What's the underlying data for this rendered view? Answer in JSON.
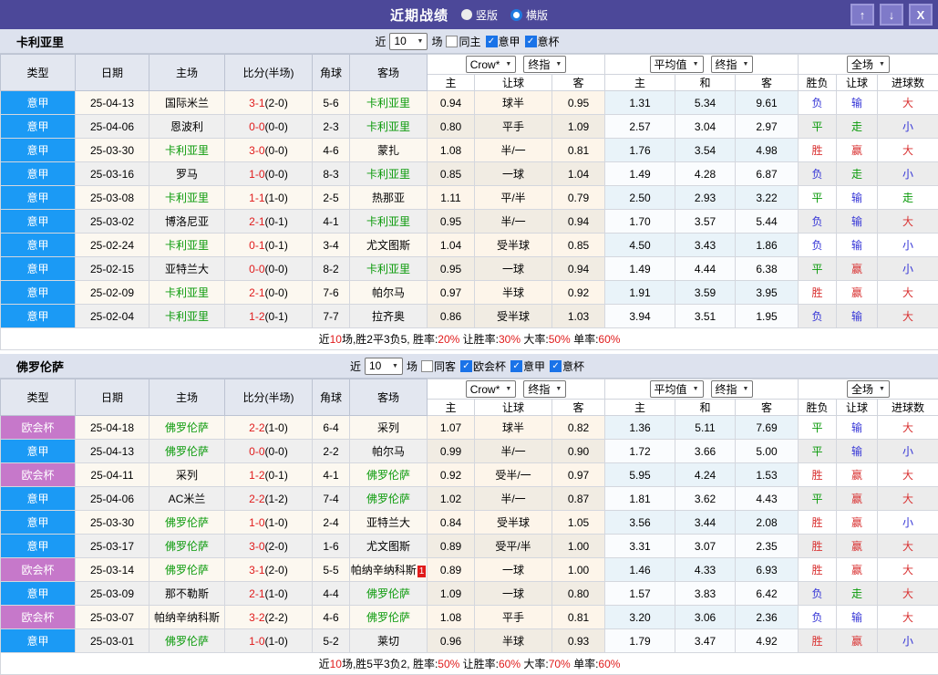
{
  "titlebar": {
    "title": "近期战绩",
    "layout_radios": [
      {
        "label": "竖版",
        "selected": false
      },
      {
        "label": "横版",
        "selected": true
      }
    ],
    "window_buttons": [
      {
        "name": "move-up",
        "glyph": "↑"
      },
      {
        "name": "move-down",
        "glyph": "↓"
      },
      {
        "name": "close",
        "glyph": "X"
      }
    ]
  },
  "colors": {
    "titlebar_purple": "#4c4899",
    "serie_a_badge_blue": "#1b9af5",
    "conference_badge_purple": "#c678ca",
    "team_highlight_green": "#0a9a0a",
    "score_red": "#e01b1b",
    "win_red": "#d93333",
    "draw_green": "#0a9a0a",
    "loss_blue": "#3434d6"
  },
  "filter_labels": {
    "recent": "近",
    "games": "场"
  },
  "columns": {
    "type": "类型",
    "date": "日期",
    "home": "主场",
    "score": "比分(半场)",
    "corner": "角球",
    "away": "客场",
    "sub": [
      "主",
      "让球",
      "客",
      "主",
      "和",
      "客",
      "胜负",
      "让球",
      "进球数"
    ],
    "dropdowns": {
      "bookmaker": "Crow*",
      "final_1": "终指",
      "average": "平均值",
      "final_2": "终指",
      "scope": "全场"
    }
  },
  "tables": [
    {
      "team": "卡利亚里",
      "filter": {
        "count": "10",
        "options": [
          {
            "label": "同主",
            "checked": false
          },
          {
            "label": "意甲",
            "checked": true
          },
          {
            "label": "意杯",
            "checked": true
          }
        ]
      },
      "rows": [
        {
          "league": "意甲",
          "league_type": "blue",
          "date": "25-04-13",
          "home": "国际米兰",
          "home_green": false,
          "score": "3-1",
          "half": "(2-0)",
          "corner": "5-6",
          "away": "卡利亚里",
          "away_green": true,
          "odds": [
            "0.94",
            "球半",
            "0.95"
          ],
          "avg": [
            "1.31",
            "5.34",
            "9.61"
          ],
          "results": [
            [
              "负",
              "b"
            ],
            [
              "输",
              "b"
            ],
            [
              "大",
              "r"
            ]
          ]
        },
        {
          "league": "意甲",
          "league_type": "blue",
          "date": "25-04-06",
          "home": "恩波利",
          "home_green": false,
          "score": "0-0",
          "half": "(0-0)",
          "corner": "2-3",
          "away": "卡利亚里",
          "away_green": true,
          "odds": [
            "0.80",
            "平手",
            "1.09"
          ],
          "avg": [
            "2.57",
            "3.04",
            "2.97"
          ],
          "results": [
            [
              "平",
              "g"
            ],
            [
              "走",
              "g"
            ],
            [
              "小",
              "b"
            ]
          ]
        },
        {
          "league": "意甲",
          "league_type": "blue",
          "date": "25-03-30",
          "home": "卡利亚里",
          "home_green": true,
          "score": "3-0",
          "half": "(0-0)",
          "corner": "4-6",
          "away": "蒙扎",
          "away_green": false,
          "odds": [
            "1.08",
            "半/一",
            "0.81"
          ],
          "avg": [
            "1.76",
            "3.54",
            "4.98"
          ],
          "results": [
            [
              "胜",
              "r"
            ],
            [
              "赢",
              "r"
            ],
            [
              "大",
              "r"
            ]
          ]
        },
        {
          "league": "意甲",
          "league_type": "blue",
          "date": "25-03-16",
          "home": "罗马",
          "home_green": false,
          "score": "1-0",
          "half": "(0-0)",
          "corner": "8-3",
          "away": "卡利亚里",
          "away_green": true,
          "odds": [
            "0.85",
            "一球",
            "1.04"
          ],
          "avg": [
            "1.49",
            "4.28",
            "6.87"
          ],
          "results": [
            [
              "负",
              "b"
            ],
            [
              "走",
              "g"
            ],
            [
              "小",
              "b"
            ]
          ]
        },
        {
          "league": "意甲",
          "league_type": "blue",
          "date": "25-03-08",
          "home": "卡利亚里",
          "home_green": true,
          "score": "1-1",
          "half": "(1-0)",
          "corner": "2-5",
          "away": "热那亚",
          "away_green": false,
          "odds": [
            "1.11",
            "平/半",
            "0.79"
          ],
          "avg": [
            "2.50",
            "2.93",
            "3.22"
          ],
          "results": [
            [
              "平",
              "g"
            ],
            [
              "输",
              "b"
            ],
            [
              "走",
              "g"
            ]
          ]
        },
        {
          "league": "意甲",
          "league_type": "blue",
          "date": "25-03-02",
          "home": "博洛尼亚",
          "home_green": false,
          "score": "2-1",
          "half": "(0-1)",
          "corner": "4-1",
          "away": "卡利亚里",
          "away_green": true,
          "odds": [
            "0.95",
            "半/一",
            "0.94"
          ],
          "avg": [
            "1.70",
            "3.57",
            "5.44"
          ],
          "results": [
            [
              "负",
              "b"
            ],
            [
              "输",
              "b"
            ],
            [
              "大",
              "r"
            ]
          ]
        },
        {
          "league": "意甲",
          "league_type": "blue",
          "date": "25-02-24",
          "home": "卡利亚里",
          "home_green": true,
          "score": "0-1",
          "half": "(0-1)",
          "corner": "3-4",
          "away": "尤文图斯",
          "away_green": false,
          "odds": [
            "1.04",
            "受半球",
            "0.85"
          ],
          "avg": [
            "4.50",
            "3.43",
            "1.86"
          ],
          "results": [
            [
              "负",
              "b"
            ],
            [
              "输",
              "b"
            ],
            [
              "小",
              "b"
            ]
          ]
        },
        {
          "league": "意甲",
          "league_type": "blue",
          "date": "25-02-15",
          "home": "亚特兰大",
          "home_green": false,
          "score": "0-0",
          "half": "(0-0)",
          "corner": "8-2",
          "away": "卡利亚里",
          "away_green": true,
          "odds": [
            "0.95",
            "一球",
            "0.94"
          ],
          "avg": [
            "1.49",
            "4.44",
            "6.38"
          ],
          "results": [
            [
              "平",
              "g"
            ],
            [
              "赢",
              "r"
            ],
            [
              "小",
              "b"
            ]
          ]
        },
        {
          "league": "意甲",
          "league_type": "blue",
          "date": "25-02-09",
          "home": "卡利亚里",
          "home_green": true,
          "score": "2-1",
          "half": "(0-0)",
          "corner": "7-6",
          "away": "帕尔马",
          "away_green": false,
          "odds": [
            "0.97",
            "半球",
            "0.92"
          ],
          "avg": [
            "1.91",
            "3.59",
            "3.95"
          ],
          "results": [
            [
              "胜",
              "r"
            ],
            [
              "赢",
              "r"
            ],
            [
              "大",
              "r"
            ]
          ]
        },
        {
          "league": "意甲",
          "league_type": "blue",
          "date": "25-02-04",
          "home": "卡利亚里",
          "home_green": true,
          "score": "1-2",
          "half": "(0-1)",
          "corner": "7-7",
          "away": "拉齐奥",
          "away_green": false,
          "odds": [
            "0.86",
            "受半球",
            "1.03"
          ],
          "avg": [
            "3.94",
            "3.51",
            "1.95"
          ],
          "results": [
            [
              "负",
              "b"
            ],
            [
              "输",
              "b"
            ],
            [
              "大",
              "r"
            ]
          ]
        }
      ],
      "footer": [
        {
          "text": "近",
          "red": false
        },
        {
          "text": "10",
          "red": true
        },
        {
          "text": "场,胜2平3负5, 胜率:",
          "red": false
        },
        {
          "text": "20%",
          "red": true
        },
        {
          "text": " 让胜率:",
          "red": false
        },
        {
          "text": "30%",
          "red": true
        },
        {
          "text": " 大率:",
          "red": false
        },
        {
          "text": "50%",
          "red": true
        },
        {
          "text": " 单率:",
          "red": false
        },
        {
          "text": "60%",
          "red": true
        }
      ]
    },
    {
      "team": "佛罗伦萨",
      "filter": {
        "count": "10",
        "options": [
          {
            "label": "同客",
            "checked": false
          },
          {
            "label": "欧会杯",
            "checked": true
          },
          {
            "label": "意甲",
            "checked": true
          },
          {
            "label": "意杯",
            "checked": true
          }
        ]
      },
      "rows": [
        {
          "league": "欧会杯",
          "league_type": "purple",
          "date": "25-04-18",
          "home": "佛罗伦萨",
          "home_green": true,
          "score": "2-2",
          "half": "(1-0)",
          "corner": "6-4",
          "away": "采列",
          "away_green": false,
          "odds": [
            "1.07",
            "球半",
            "0.82"
          ],
          "avg": [
            "1.36",
            "5.11",
            "7.69"
          ],
          "results": [
            [
              "平",
              "g"
            ],
            [
              "输",
              "b"
            ],
            [
              "大",
              "r"
            ]
          ]
        },
        {
          "league": "意甲",
          "league_type": "blue",
          "date": "25-04-13",
          "home": "佛罗伦萨",
          "home_green": true,
          "score": "0-0",
          "half": "(0-0)",
          "corner": "2-2",
          "away": "帕尔马",
          "away_green": false,
          "odds": [
            "0.99",
            "半/一",
            "0.90"
          ],
          "avg": [
            "1.72",
            "3.66",
            "5.00"
          ],
          "results": [
            [
              "平",
              "g"
            ],
            [
              "输",
              "b"
            ],
            [
              "小",
              "b"
            ]
          ]
        },
        {
          "league": "欧会杯",
          "league_type": "purple",
          "date": "25-04-11",
          "home": "采列",
          "home_green": false,
          "score": "1-2",
          "half": "(0-1)",
          "corner": "4-1",
          "away": "佛罗伦萨",
          "away_green": true,
          "odds": [
            "0.92",
            "受半/一",
            "0.97"
          ],
          "avg": [
            "5.95",
            "4.24",
            "1.53"
          ],
          "results": [
            [
              "胜",
              "r"
            ],
            [
              "赢",
              "r"
            ],
            [
              "大",
              "r"
            ]
          ]
        },
        {
          "league": "意甲",
          "league_type": "blue",
          "date": "25-04-06",
          "home": "AC米兰",
          "home_green": false,
          "score": "2-2",
          "half": "(1-2)",
          "corner": "7-4",
          "away": "佛罗伦萨",
          "away_green": true,
          "odds": [
            "1.02",
            "半/一",
            "0.87"
          ],
          "avg": [
            "1.81",
            "3.62",
            "4.43"
          ],
          "results": [
            [
              "平",
              "g"
            ],
            [
              "赢",
              "r"
            ],
            [
              "大",
              "r"
            ]
          ]
        },
        {
          "league": "意甲",
          "league_type": "blue",
          "date": "25-03-30",
          "home": "佛罗伦萨",
          "home_green": true,
          "score": "1-0",
          "half": "(1-0)",
          "corner": "2-4",
          "away": "亚特兰大",
          "away_green": false,
          "odds": [
            "0.84",
            "受半球",
            "1.05"
          ],
          "avg": [
            "3.56",
            "3.44",
            "2.08"
          ],
          "results": [
            [
              "胜",
              "r"
            ],
            [
              "赢",
              "r"
            ],
            [
              "小",
              "b"
            ]
          ]
        },
        {
          "league": "意甲",
          "league_type": "blue",
          "date": "25-03-17",
          "home": "佛罗伦萨",
          "home_green": true,
          "score": "3-0",
          "half": "(2-0)",
          "corner": "1-6",
          "away": "尤文图斯",
          "away_green": false,
          "odds": [
            "0.89",
            "受平/半",
            "1.00"
          ],
          "avg": [
            "3.31",
            "3.07",
            "2.35"
          ],
          "results": [
            [
              "胜",
              "r"
            ],
            [
              "赢",
              "r"
            ],
            [
              "大",
              "r"
            ]
          ]
        },
        {
          "league": "欧会杯",
          "league_type": "purple",
          "date": "25-03-14",
          "home": "佛罗伦萨",
          "home_green": true,
          "score": "3-1",
          "half": "(2-0)",
          "corner": "5-5",
          "away": "帕纳辛纳科斯",
          "away_green": false,
          "away_badge": "1",
          "odds": [
            "0.89",
            "一球",
            "1.00"
          ],
          "avg": [
            "1.46",
            "4.33",
            "6.93"
          ],
          "results": [
            [
              "胜",
              "r"
            ],
            [
              "赢",
              "r"
            ],
            [
              "大",
              "r"
            ]
          ]
        },
        {
          "league": "意甲",
          "league_type": "blue",
          "date": "25-03-09",
          "home": "那不勒斯",
          "home_green": false,
          "score": "2-1",
          "half": "(1-0)",
          "corner": "4-4",
          "away": "佛罗伦萨",
          "away_green": true,
          "odds": [
            "1.09",
            "一球",
            "0.80"
          ],
          "avg": [
            "1.57",
            "3.83",
            "6.42"
          ],
          "results": [
            [
              "负",
              "b"
            ],
            [
              "走",
              "g"
            ],
            [
              "大",
              "r"
            ]
          ]
        },
        {
          "league": "欧会杯",
          "league_type": "purple",
          "date": "25-03-07",
          "home": "帕纳辛纳科斯",
          "home_green": false,
          "score": "3-2",
          "half": "(2-2)",
          "corner": "4-6",
          "away": "佛罗伦萨",
          "away_green": true,
          "odds": [
            "1.08",
            "平手",
            "0.81"
          ],
          "avg": [
            "3.20",
            "3.06",
            "2.36"
          ],
          "results": [
            [
              "负",
              "b"
            ],
            [
              "输",
              "b"
            ],
            [
              "大",
              "r"
            ]
          ]
        },
        {
          "league": "意甲",
          "league_type": "blue",
          "date": "25-03-01",
          "home": "佛罗伦萨",
          "home_green": true,
          "score": "1-0",
          "half": "(1-0)",
          "corner": "5-2",
          "away": "莱切",
          "away_green": false,
          "odds": [
            "0.96",
            "半球",
            "0.93"
          ],
          "avg": [
            "1.79",
            "3.47",
            "4.92"
          ],
          "results": [
            [
              "胜",
              "r"
            ],
            [
              "赢",
              "r"
            ],
            [
              "小",
              "b"
            ]
          ]
        }
      ],
      "footer": [
        {
          "text": "近",
          "red": false
        },
        {
          "text": "10",
          "red": true
        },
        {
          "text": "场,胜5平3负2, 胜率:",
          "red": false
        },
        {
          "text": "50%",
          "red": true
        },
        {
          "text": " 让胜率:",
          "red": false
        },
        {
          "text": "60%",
          "red": true
        },
        {
          "text": " 大率:",
          "red": false
        },
        {
          "text": "70%",
          "red": true
        },
        {
          "text": " 单率:",
          "red": false
        },
        {
          "text": "60%",
          "red": true
        }
      ]
    }
  ]
}
